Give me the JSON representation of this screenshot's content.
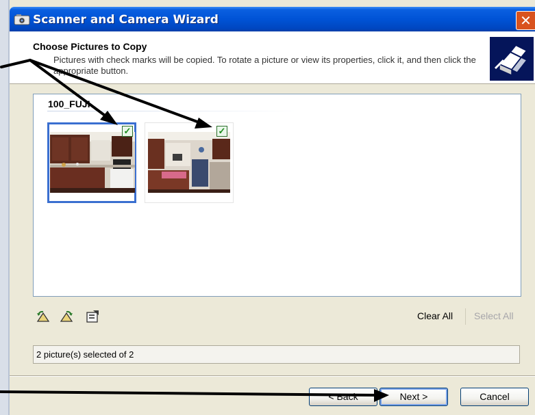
{
  "window": {
    "title": "Scanner and Camera Wizard",
    "close_glyph": "✕"
  },
  "header": {
    "title": "Choose Pictures to Copy",
    "description": "Pictures with check marks will be copied. To rotate a picture or view its properties, click it, and then click the appropriate button.",
    "icon": "scanner-wizard-icon"
  },
  "group": {
    "label": "100_FUJI"
  },
  "pictures": [
    {
      "name": "picture-1",
      "checked": true,
      "selected": true,
      "check_glyph": "✓"
    },
    {
      "name": "picture-2",
      "checked": true,
      "selected": false,
      "check_glyph": "✓"
    }
  ],
  "toolbar": {
    "icons": [
      "rotate-left-icon",
      "rotate-right-icon",
      "properties-icon"
    ],
    "clear_all": "Clear All",
    "select_all": "Select All"
  },
  "status": {
    "text": "2 picture(s) selected of 2"
  },
  "buttons": {
    "back": "< Back",
    "next": "Next >",
    "cancel": "Cancel"
  },
  "colors": {
    "titlebar": "#0053d6",
    "selection_border": "#3a6fd0",
    "check": "#1c8a1c",
    "annotation_arrow": "#000000"
  }
}
